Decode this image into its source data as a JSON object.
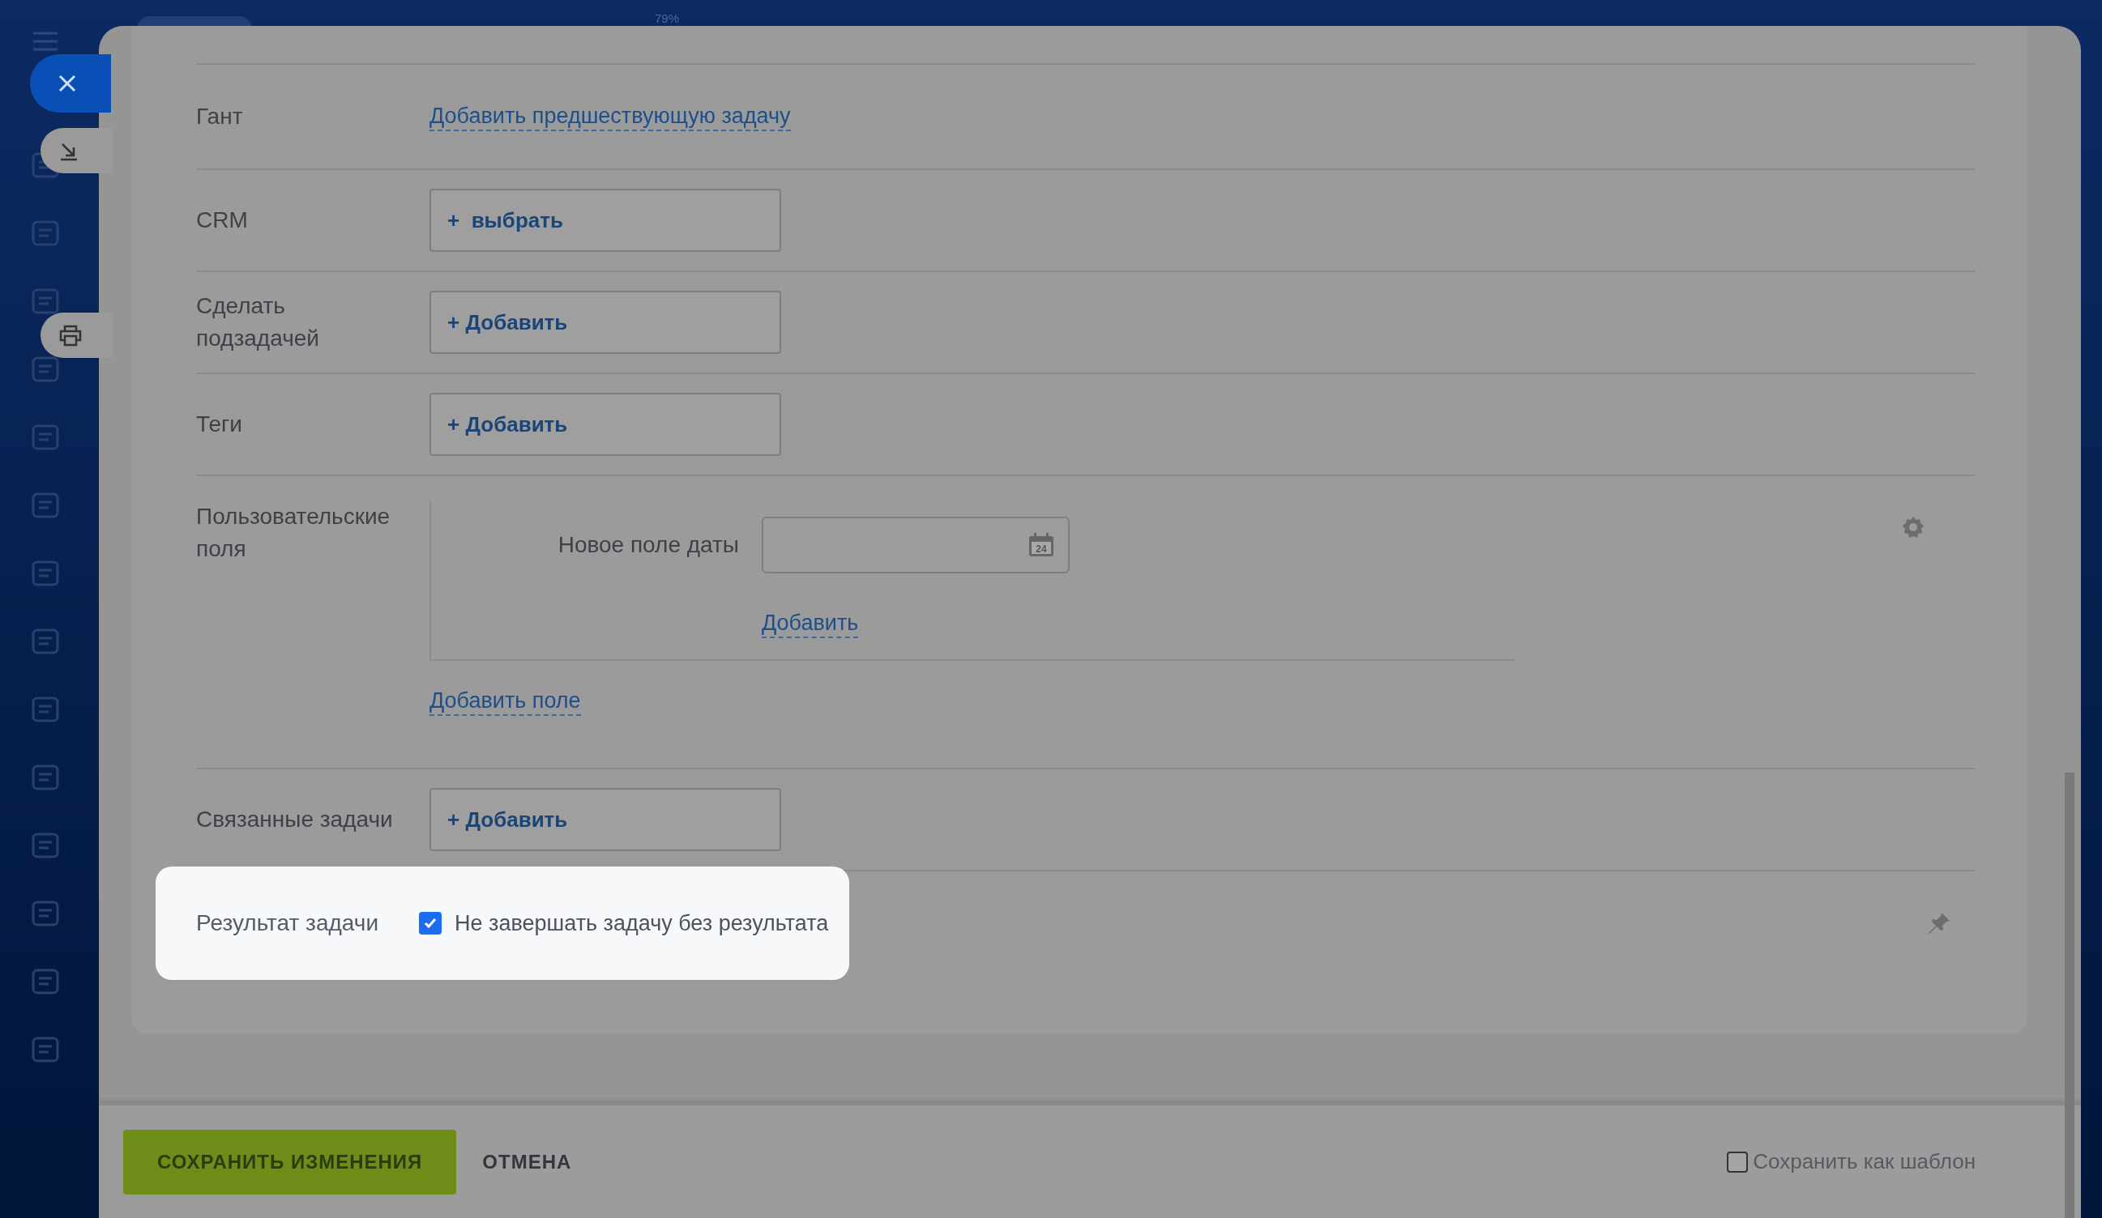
{
  "zoom_label": "79%",
  "fields": [
    {
      "kind": "link",
      "label": "Гант",
      "link": "Добавить предшествующую задачу"
    },
    {
      "kind": "button",
      "label": "CRM",
      "button": "+  выбрать"
    },
    {
      "kind": "button",
      "label": "Сделать подзадачей",
      "button": "+ Добавить"
    },
    {
      "kind": "button",
      "label": "Теги",
      "button": "+ Добавить"
    },
    {
      "kind": "custom",
      "label": "Пользовательские поля",
      "field_label": "Новое поле даты",
      "calendar_day": "24",
      "add_link": "Добавить",
      "add_field_link": "Добавить поле"
    },
    {
      "kind": "button",
      "label": "Связанные задачи",
      "button": "+ Добавить"
    },
    {
      "kind": "checkbox",
      "label": "Результат задачи",
      "checkbox_label": "Не завершать задачу без результата",
      "checked": true,
      "highlighted": true
    }
  ],
  "footer": {
    "save": "СОХРАНИТЬ ИЗМЕНЕНИЯ",
    "cancel": "ОТМЕНА",
    "template": {
      "label": "Сохранить как шаблон",
      "checked": false
    }
  }
}
